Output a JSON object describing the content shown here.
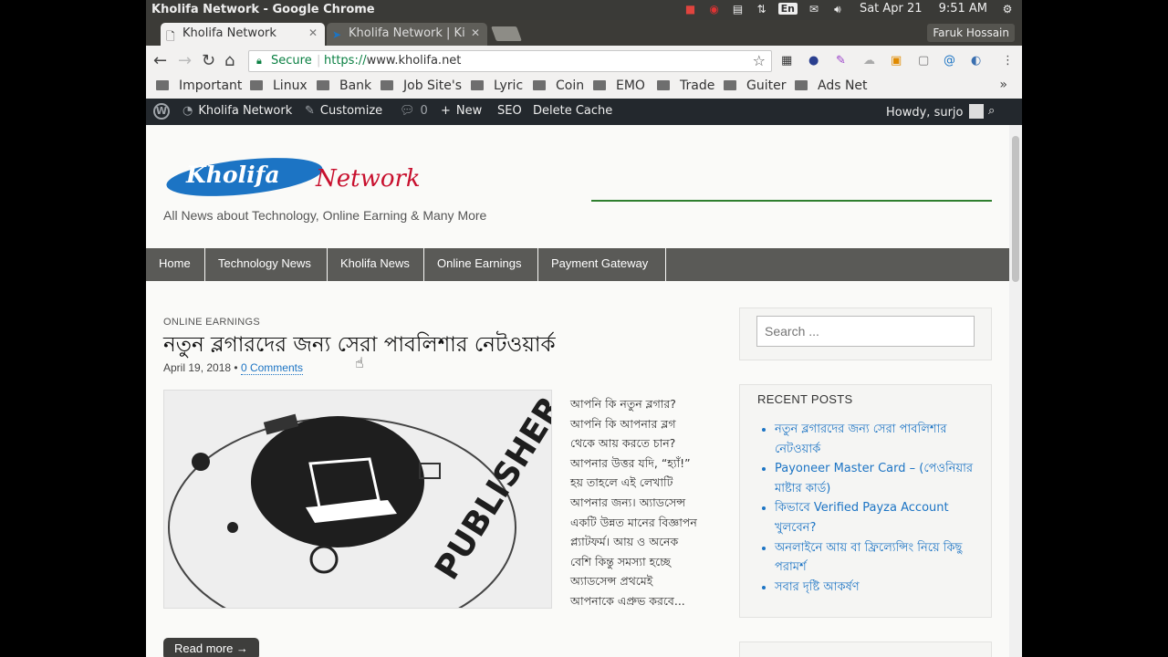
{
  "os": {
    "window_title": "Kholifa Network - Google Chrome",
    "lang": "En",
    "datetime": "Sat Apr 21",
    "time": "9:51 AM"
  },
  "browser": {
    "tabs": [
      {
        "label": "Kholifa Network"
      },
      {
        "label": "Kholifa Network | Ki"
      }
    ],
    "profile_name": "Faruk Hossain",
    "secure_label": "Secure",
    "url_scheme": "https://",
    "url_host": "www.kholifa.net",
    "bookmarks": [
      "Important",
      "Linux",
      "Bank",
      "Job Site's",
      "Lyric",
      "Coin",
      "EMO",
      "Trade",
      "Guiter",
      "Ads Net"
    ],
    "bookmarks_more": "»"
  },
  "wp_admin": {
    "site_name": "Kholifa Network",
    "customize": "Customize",
    "comments_count": "0",
    "new_label": "New",
    "seo": "SEO",
    "delete_cache": "Delete Cache",
    "howdy": "Howdy, surjo"
  },
  "site": {
    "logo_text_left": "Kholifa",
    "logo_text_right": "Network",
    "tagline": "All News about Technology, Online Earning & Many More",
    "nav": [
      "Home",
      "Technology News",
      "Kholifa News",
      "Online Earnings",
      "Payment Gateway"
    ]
  },
  "post": {
    "category": "ONLINE EARNINGS",
    "title": "নতুন ব্লগারদের জন্য সেরা পাবলিশার নেটওয়ার্ক",
    "date": "April 19, 2018",
    "bullet": "•",
    "comments_link": "0 Comments",
    "excerpt_lines": [
      "আপনি কি নতুন ব্লগার?",
      "আপনি কি আপনার ব্লগ",
      "থেকে আয় করতে চান?",
      "আপনার উত্তর যদি, “হ্যাঁ!”",
      "হয় তাহলে এই লেখাটি",
      "আপনার জন্য। অ্যাডসেন্স",
      "একটি উন্নত মানের বিজ্ঞাপন",
      "প্ল্যাটফর্ম। আয় ও অনেক",
      "বেশি কিন্তু সমস্যা হচ্ছে",
      "অ্যাডসেন্স প্রথমেই",
      "আপনাকে এপ্রুভ করবে..."
    ],
    "thumbnail_text": "PUBLISHER",
    "read_more": "Read more →"
  },
  "sidebar": {
    "search_placeholder": "Search ...",
    "recent_title": "RECENT POSTS",
    "recent_posts": [
      "নতুন ব্লগারদের জন্য সেরা পাবলিশার নেটওয়ার্ক",
      "Payoneer Master Card – (পেওনিয়ার মাষ্টার কার্ড)",
      "কিভাবে Verified Payza Account খুলবেন?",
      "অনলাইনে আয় বা ফ্রিল্যেন্সিং নিয়ে কিছু পরামর্শ",
      "সবার দৃষ্টি আকর্ষণ"
    ]
  }
}
